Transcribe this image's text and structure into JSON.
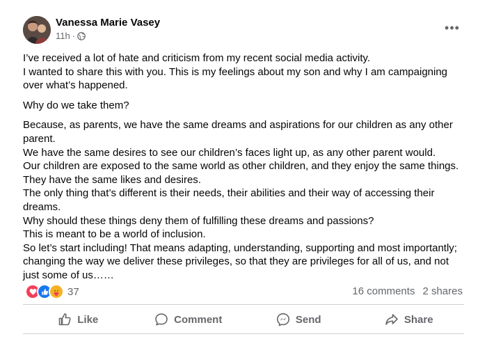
{
  "post": {
    "author": "Vanessa Marie Vasey",
    "time": "11h",
    "separator": "·",
    "audience_icon": "globe-icon",
    "more_icon": "more-options-icon",
    "more_glyph": "•••",
    "paragraphs": [
      "I’ve received a lot of hate and criticism from my recent social media activity.\nI wanted to share this with you. This is my feelings about my son and why I am campaigning over what’s happened.",
      "Why do we take them?",
      "Because, as parents, we have the same dreams and aspirations for our children as any other parent.\nWe have the same desires to see our children’s faces light up, as any other parent would.\nOur children are exposed to the same world as other children, and they enjoy the same things.\nThey have the same likes and desires.\nThe only thing that’s different is their needs, their abilities and their way of accessing their dreams.\nWhy should these things deny them of fulfilling these dreams and passions?\nThis is meant to be a world of inclusion.\nSo let’s start including! That means adapting, understanding, supporting and most importantly; changing the way we deliver these privileges, so that they are privileges for all of us, and not just some of us……"
    ]
  },
  "engagement": {
    "reaction_icons": [
      "love-reaction-icon",
      "like-reaction-icon",
      "care-reaction-icon"
    ],
    "reaction_count": "37",
    "comments": "16 comments",
    "shares": "2 shares"
  },
  "actions": {
    "like": "Like",
    "comment": "Comment",
    "send": "Send",
    "share": "Share"
  },
  "colors": {
    "text": "#050505",
    "secondary": "#65676b",
    "divider": "#ced0d4",
    "love": "#f33e58",
    "like": "#1877f2",
    "care": "#f7b125"
  }
}
